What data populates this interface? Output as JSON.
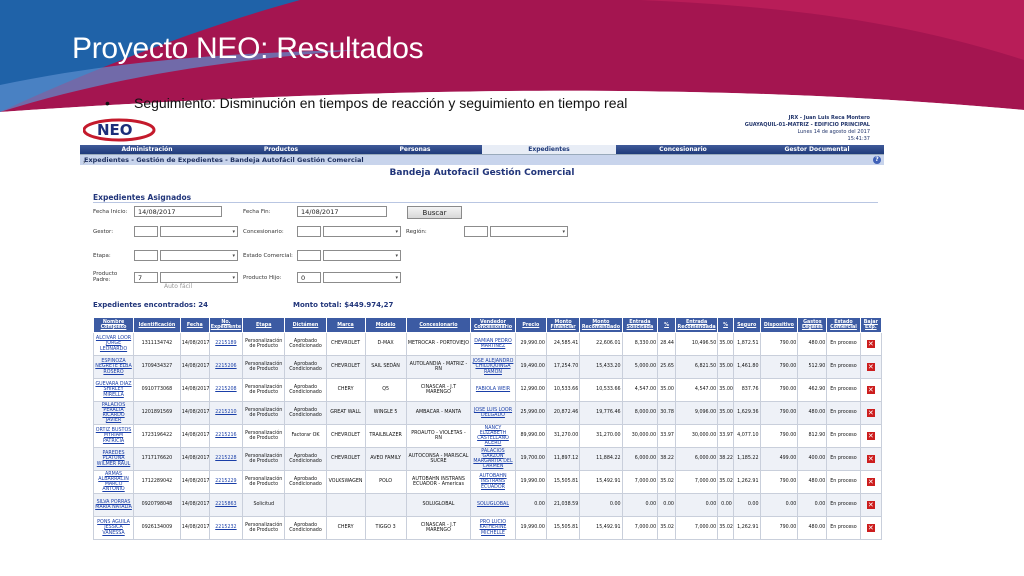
{
  "slide": {
    "title": "Proyecto NEO: Resultados",
    "bullet": "Seguimiento: Disminución en tiempos de reacción y seguimiento en tiempo real",
    "bullet_marker": "•",
    "colors": {
      "magenta": "#a41550",
      "blue": "#1f62a8"
    }
  },
  "app": {
    "logo_text": "NEO",
    "user": {
      "name": "JRX - Juan Luis Reca Montero",
      "location": "GUAYAQUIL-01-MATRIZ - EDIFICIO PRINCIPAL",
      "date": "Lunes 14 de agosto del 2017",
      "time": "15:41:37"
    },
    "menu": [
      "Administración",
      "Productos",
      "Personas",
      "Expedientes",
      "Concesionario",
      "Gestor Documental"
    ],
    "breadcrumb": "Expedientes - Gestión de Expedientes - Bandeja Autofácil Gestión Comercial",
    "help_icon": "question-icon",
    "panel_title": "Bandeja Autofacil Gestión Comercial",
    "section_title": "Expedientes Asignados",
    "filters": {
      "fecha_inicio_label": "Fecha Inicio:",
      "fecha_inicio": "14/08/2017",
      "fecha_fin_label": "Fecha Fin:",
      "fecha_fin": "14/08/2017",
      "buscar": "Buscar",
      "gestor_label": "Gestor:",
      "concesionario_label": "Concesionario:",
      "region_label": "Región:",
      "etapa_label": "Etapa:",
      "estado_label": "Estado Comercial:",
      "producto_padre_label": "Producto Padre:",
      "producto_padre_code": "7",
      "producto_padre_value": "Auto fácil",
      "producto_hijo_label": "Producto Hijo:",
      "producto_hijo_code": "0"
    },
    "found_label": "Expedientes encontrados: 24",
    "total_label": "Monto total: $449.974,27",
    "columns": [
      "Nombre Completo",
      "Identificación",
      "Fecha",
      "No. Expediente",
      "Etapa",
      "Dictámen",
      "Marca",
      "Modelo",
      "Concesionario",
      "Vendedor Concesionario",
      "Precio",
      "Monto Financiar",
      "Monto Recomendado",
      "Entrada Solicitada",
      "%",
      "Entrada Recomendada",
      "%",
      "Seguro",
      "Dispositivo",
      "Gastos Legales",
      "Estado Comercial",
      "Bajar Exp."
    ],
    "rows": [
      [
        "ALCIVAR LOOR JORGE LEONARDO",
        "1311134742",
        "14/08/2017",
        "2215189",
        "Personalización de Producto",
        "Aprobado Condicionado",
        "CHEVROLET",
        "D-MAX",
        "METROCAR - PORTOVIEJO",
        "DAMIAN PEDRO MARTINEZ",
        "29,990.00",
        "24,585.41",
        "22,606.01",
        "8,330.00",
        "28.44",
        "10,496.50",
        "35.00",
        "1,872.51",
        "790.00",
        "480.00",
        "En proceso"
      ],
      [
        "ESPINOZA NEGRETE ELBA ROSERO",
        "1709434327",
        "14/08/2017",
        "2215206",
        "Personalización de Producto",
        "Aprobado Condicionado",
        "CHEVROLET",
        "SAIL SEDÁN",
        "AUTOLANDIA - MATRIZ -RN",
        "JOSE ALEJANDRO CHILUIQUINGA RAMON",
        "19,490.00",
        "17,254.70",
        "15,433.20",
        "5,000.00",
        "25.65",
        "6,821.50",
        "35.00",
        "1,461.80",
        "790.00",
        "512.90",
        "En proceso"
      ],
      [
        "GUEVARA DIAZ SHIRLEY MIRELLA",
        "0910773068",
        "14/08/2017",
        "2215208",
        "Personalización de Producto",
        "Aprobado Condicionado",
        "CHERY",
        "Q5",
        "CINASCAR - J.T MARENGO",
        "FABIOLA WEIR",
        "12,990.00",
        "10,533.66",
        "10,533.66",
        "4,547.00",
        "35.00",
        "4,547.00",
        "35.00",
        "837.76",
        "790.00",
        "462.90",
        "En proceso"
      ],
      [
        "PALACIOS PERALTA RICARDO JAVIER",
        "1201891569",
        "14/08/2017",
        "2215210",
        "Personalización de Producto",
        "Aprobado Condicionado",
        "GREAT WALL",
        "WINGLE 5",
        "AMBACAR - MANTA",
        "JOSE LUIS LOOR DELGADO",
        "25,990.00",
        "20,872.46",
        "19,776.46",
        "8,000.00",
        "30.78",
        "9,096.00",
        "35.00",
        "1,629.36",
        "790.00",
        "480.00",
        "En proceso"
      ],
      [
        "ORTIZ BUSTOS MYRIAM PATRICIA",
        "1723196422",
        "14/08/2017",
        "2215216",
        "Personalización de Producto",
        "Factorar OK",
        "CHEVROLET",
        "TRAILBLAZER",
        "PROAUTO - VIOLETAS - RN",
        "NANCY ELIZABETH CASTELLANO ACERO",
        "89,990.00",
        "31,270.00",
        "31,270.00",
        "30,000.00",
        "33.97",
        "30,000.00",
        "33.97",
        "4,077.10",
        "790.00",
        "812.90",
        "En proceso"
      ],
      [
        "PAREDES PLATUNA WILMER RAUL",
        "1717176620",
        "14/08/2017",
        "2215228",
        "Personalización de Producto",
        "Aprobado Condicionado",
        "CHEVROLET",
        "AVEO FAMILY",
        "AUTOCONSA - MARISCAL SUCRE",
        "PALACIOS GARZON MARGARITA DEL CARMEN",
        "19,700.00",
        "11,897.12",
        "11,884.22",
        "6,000.00",
        "38.22",
        "6,000.00",
        "38.22",
        "1,185.22",
        "499.00",
        "400.00",
        "En proceso"
      ],
      [
        "ARMAS ALBARRACIN MARCO ANTONIO",
        "1712289042",
        "14/08/2017",
        "2215229",
        "Personalización de Producto",
        "Aprobado Condicionado",
        "VOLKSWAGEN",
        "POLO",
        "AUTOBAHN INSTRANS ECUADOR - Americas",
        "AUTOBAHN INSTRANS ECUADOR",
        "19,990.00",
        "15,505.81",
        "15,492.91",
        "7,000.00",
        "35.02",
        "7,000.00",
        "35.02",
        "1,262.91",
        "790.00",
        "480.00",
        "En proceso"
      ],
      [
        "SILVA PORRAS MARIA NATALIA",
        "0920798048",
        "14/08/2017",
        "2215863",
        "Solicitud",
        "",
        "",
        "",
        "SOLUGLOBAL",
        "SOLUGLOBAL",
        "0.00",
        "21,038.59",
        "0.00",
        "0.00",
        "0.00",
        "0.00",
        "0.00",
        "0.00",
        "0.00",
        "0.00",
        "En proceso"
      ],
      [
        "PONS AGUILA JESSICA VANESSA",
        "0926134009",
        "14/08/2017",
        "2215232",
        "Personalización de Producto",
        "Aprobado Condicionado",
        "CHERY",
        "TIGGO 3",
        "CINASCAR - J.T MARENGO",
        "PRO LUCIO KATHERINE MICHELLE",
        "19,990.00",
        "15,505.81",
        "15,492.91",
        "7,000.00",
        "35.02",
        "7,000.00",
        "35.02",
        "1,262.91",
        "790.00",
        "480.00",
        "En proceso"
      ]
    ]
  }
}
